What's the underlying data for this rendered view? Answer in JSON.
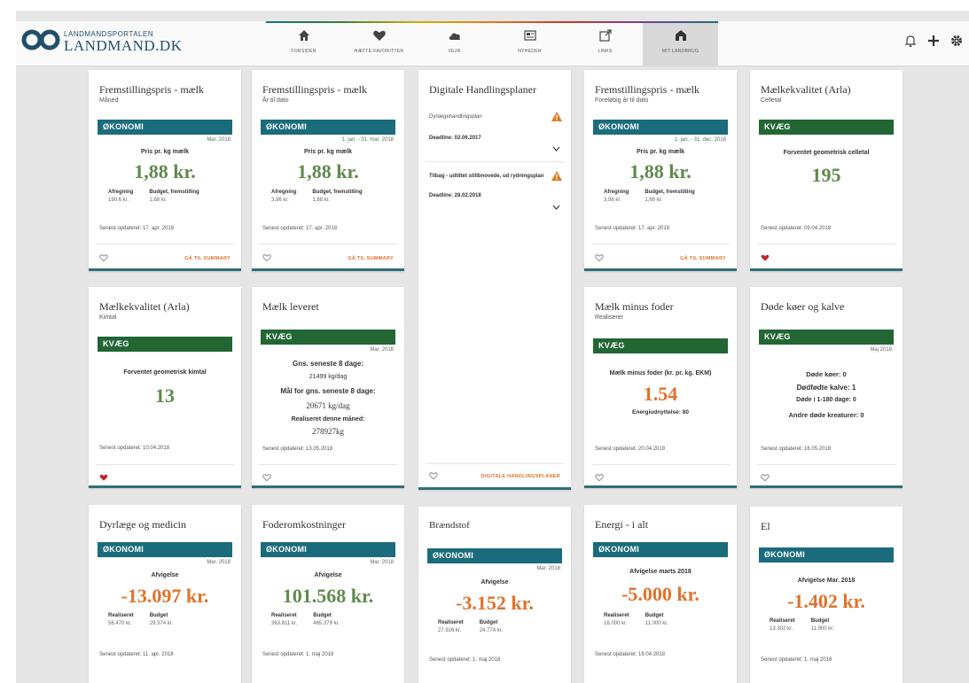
{
  "logo": {
    "small": "LANDMANDSPORTALEN",
    "big": "LANDMAND.DK"
  },
  "nav": [
    {
      "label": "Forsiden",
      "icon": "home-icon"
    },
    {
      "label": "Hæfte-favoritter",
      "icon": "heart-icon"
    },
    {
      "label": "Vejr",
      "icon": "cloud-icon"
    },
    {
      "label": "Nyheder",
      "icon": "newspaper-icon"
    },
    {
      "label": "Links",
      "icon": "external-link-icon"
    },
    {
      "label": "Mit landbrug",
      "icon": "farm-icon"
    }
  ],
  "cards": {
    "c1": {
      "title": "Fremstillingspris - mælk",
      "sub": "Måned",
      "category": "ØKONOMI",
      "period": "Mar. 2018",
      "metric": "Pris pr. kg mælk",
      "value": "1,88 kr.",
      "col1_k": "Afregning",
      "col1_v": "190,6 kr.",
      "col2_k": "Budget, fremstilling",
      "col2_v": "1,68 kr.",
      "updated": "Senest opdateret: 17. apr. 2018",
      "link": "GÅ TIL SUMMARY"
    },
    "c2": {
      "title": "Fremstillingspris - mælk",
      "sub": "År til dato",
      "category": "ØKONOMI",
      "period": "1. jan. - 31. mar. 2018",
      "metric": "Pris pr. kg mælk",
      "value": "1,88 kr.",
      "col1_k": "Afregning",
      "col1_v": "3,96 kr.",
      "col2_k": "Budget, fremstilling",
      "col2_v": "1,88 kr.",
      "updated": "Senest opdateret: 17. apr. 2018",
      "link": "GÅ TIL SUMMARY"
    },
    "c3": {
      "title": "Digitale Handlingsplaner",
      "p1_label": "Dyrlægehandlingsplan",
      "p1_deadline": "Deadline: 02.06.2017",
      "p2_label": "Tilbag - udtiltet stillbnovede, ud rydningsplan",
      "p2_deadline": "Deadline: 28.02.2018",
      "link": "DIGITALE HANDLINGSPLANER"
    },
    "c4": {
      "title": "Fremstillingspris - mælk",
      "sub": "Foreløbig år til dato",
      "category": "ØKONOMI",
      "period": "1. jan. - 31. dec. 2018",
      "metric": "Pris pr. kg mælk",
      "value": "1,88 kr.",
      "col1_k": "Afregning",
      "col1_v": "3,96 kr.",
      "col2_k": "Budget, fremstilling",
      "col2_v": "1,68 kr.",
      "updated": "Senest opdateret: 17. apr. 2018",
      "link": "GÅ TIL SUMMARY"
    },
    "c5": {
      "title": "Mælkekvalitet (Arla)",
      "sub": "Celletal",
      "category": "KVÆG",
      "metric": "Forventet geometrisk celletal",
      "value": "195",
      "updated": "Senest opdateret: 09.04.2018"
    },
    "c6": {
      "title": "Mælkekvalitet (Arla)",
      "sub": "Kimtal",
      "category": "KVÆG",
      "metric": "Forventet geometrisk kimtal",
      "value": "13",
      "updated": "Senest opdateret: 10.04.2018"
    },
    "c7": {
      "title": "Mælk leveret",
      "category": "KVÆG",
      "period": "Mar. 2018",
      "l1": "Gns. seneste 8 dage:",
      "l2": "21499 kg/dag",
      "l3": "Mål for gns. seneste 8 dage:",
      "l4": "20671 kg/dag",
      "l5": "Realiseret denne måned:",
      "l6": "278927kg",
      "updated": "Senest opdateret: 13.05.2018"
    },
    "c8": {
      "title": "Mælk minus foder",
      "sub": "Realiseret",
      "category": "KVÆG",
      "metric": "Mælk minus foder (kr. pr. kg. EKM)",
      "value": "1.54",
      "extra": "Energiudnyttelse: 80",
      "updated": "Senest opdateret: 20.04.2018"
    },
    "c9": {
      "title": "Døde køer og kalve",
      "category": "KVÆG",
      "period": "Maj 2018",
      "l1": "Døde køer: 0",
      "l2": "Dødfødte kalve: 1",
      "l3": "Døde i 1-180 dage: 0",
      "l4": "Andre døde kreaturer: 0",
      "updated": "Senest opdateret: 16.05.2018"
    },
    "c10": {
      "title": "Dyrlæge og medicin",
      "category": "ØKONOMI",
      "period": "Mar. 2018",
      "metric": "Afvigelse",
      "value": "-13.097 kr.",
      "col1_k": "Realiseret",
      "col1_v": "56.470 kr.",
      "col2_k": "Budget",
      "col2_v": "29.374 kr.",
      "updated": "Senest opdateret: 11. apr. 2018"
    },
    "c11": {
      "title": "Foderomkostninger",
      "category": "ØKONOMI",
      "period": "Mar. 2018",
      "metric": "Afvigelse",
      "value": "101.568 kr.",
      "col1_k": "Realiseret",
      "col1_v": "363.811 kr.",
      "col2_k": "Budget",
      "col2_v": "465.379 kr.",
      "updated": "Senest opdateret: 1. maj 2018"
    },
    "c12": {
      "title": "Brændstof",
      "category": "ØKONOMI",
      "period": "Mar. 2018",
      "metric": "Afvigelse",
      "value": "-3.152 kr.",
      "col1_k": "Realiseret",
      "col1_v": "27.926 kr.",
      "col2_k": "Budget",
      "col2_v": "24.774 kr.",
      "updated": "Senest opdateret: 1. maj 2018"
    },
    "c13": {
      "title": "Energi - i alt",
      "category": "ØKONOMI",
      "metric": "Afvigelse marts 2018",
      "value": "-5.000 kr.",
      "col1_k": "Realiseret",
      "col1_v": "16.000 kr.",
      "col2_k": "Budget",
      "col2_v": "11.000 kr.",
      "updated": "Senest opdateret: 19.04.2018"
    },
    "c14": {
      "title": "El",
      "category": "ØKONOMI",
      "metric": "Afvigelse Mar. 2018",
      "value": "-1.402 kr.",
      "col1_k": "Realiseret",
      "col1_v": "13.302 kr.",
      "col2_k": "Budget",
      "col2_v": "11.900 kr.",
      "updated": "Senest opdateret: 1. maj 2018"
    }
  },
  "colors": {
    "okonomi": "#1a6c7d",
    "kvaeg": "#226634",
    "accent": "#e0722a",
    "green_value": "#5f8a4c",
    "favorite": "#c0262d"
  }
}
